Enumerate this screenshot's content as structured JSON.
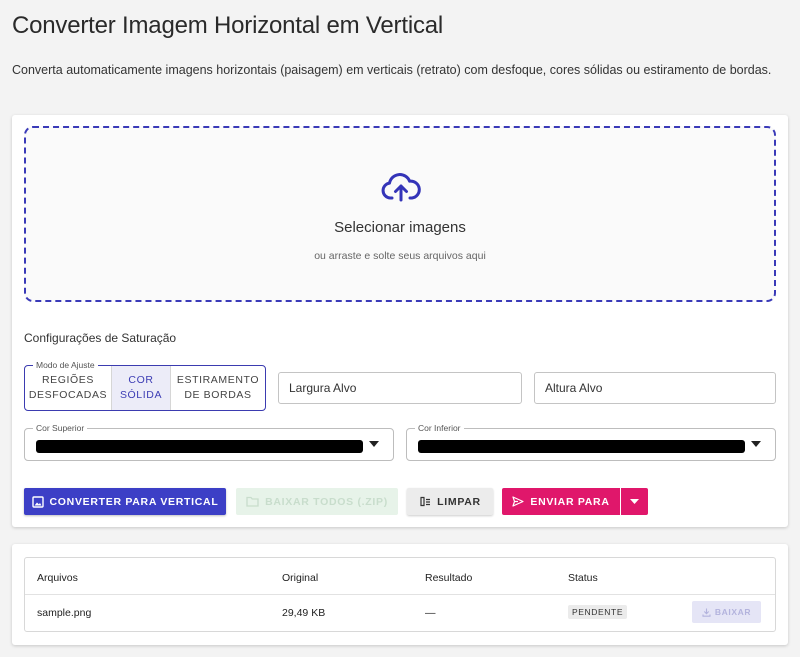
{
  "page": {
    "title": "Converter Imagem Horizontal em Vertical",
    "description": "Converta automaticamente imagens horizontais (paisagem) em verticais (retrato) com desfoque, cores sólidas ou estiramento de bordas."
  },
  "dropzone": {
    "icon": "cloud-upload-icon",
    "title": "Selecionar imagens",
    "subtitle": "ou arraste e solte seus arquivos aqui"
  },
  "settings": {
    "title": "Configurações de Saturação",
    "mode": {
      "legend": "Modo de Ajuste",
      "options": [
        "REGIÕES DESFOCADAS",
        "COR SÓLIDA",
        "ESTIRAMENTO DE BORDAS"
      ],
      "selected": "COR SÓLIDA"
    },
    "width_placeholder": "Largura Alvo",
    "height_placeholder": "Altura Alvo",
    "top_color": {
      "legend": "Cor Superior",
      "value": "#000000"
    },
    "bottom_color": {
      "legend": "Cor Inferior",
      "value": "#000000"
    }
  },
  "actions": {
    "convert": "CONVERTER PARA VERTICAL",
    "download_all": "BAIXAR TODOS (.ZIP)",
    "clear": "LIMPAR",
    "send_to": "ENVIAR PARA"
  },
  "table": {
    "headers": [
      "Arquivos",
      "Original",
      "Resultado",
      "Status"
    ],
    "rows": [
      {
        "file": "sample.png",
        "original": "29,49 KB",
        "result": "—",
        "status": "PENDENTE",
        "action": "BAIXAR"
      }
    ]
  },
  "colors": {
    "accent": "#3c3fc6",
    "send": "#e0176b",
    "disabled_green": "#e7f3e9",
    "background": "#f3f3f3"
  }
}
